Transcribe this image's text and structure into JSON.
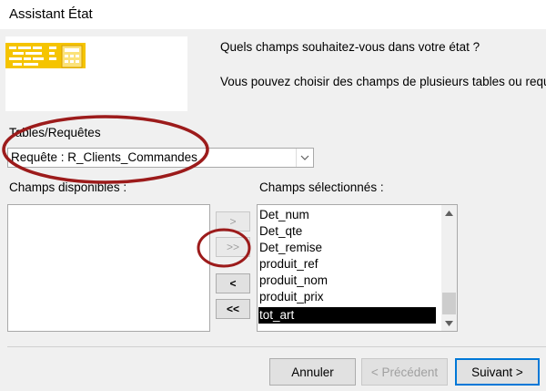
{
  "window": {
    "title": "Assistant État"
  },
  "prompt": {
    "line1": "Quels champs souhaitez-vous dans votre état ?",
    "line2": "Vous pouvez choisir des champs de plusieurs tables ou requêtes"
  },
  "tables": {
    "label": "Tables/Requêtes",
    "selected": "Requête : R_Clients_Commandes"
  },
  "available": {
    "label": "Champs disponibles :",
    "items": []
  },
  "selected_fields": {
    "label": "Champs sélectionnés :",
    "items": [
      "Det_num",
      "Det_qte",
      "Det_remise",
      "produit_ref",
      "produit_nom",
      "produit_prix",
      "tot_art"
    ],
    "active": "tot_art"
  },
  "move_buttons": {
    "add": ">",
    "add_all": ">>",
    "remove": "<",
    "remove_all": "<<"
  },
  "footer": {
    "cancel": "Annuler",
    "back": "< Précédent",
    "next": "Suivant >"
  },
  "colors": {
    "annotation": "#9c1b1b",
    "preview_yellow": "#f5c400",
    "focus_blue": "#0078d7"
  }
}
